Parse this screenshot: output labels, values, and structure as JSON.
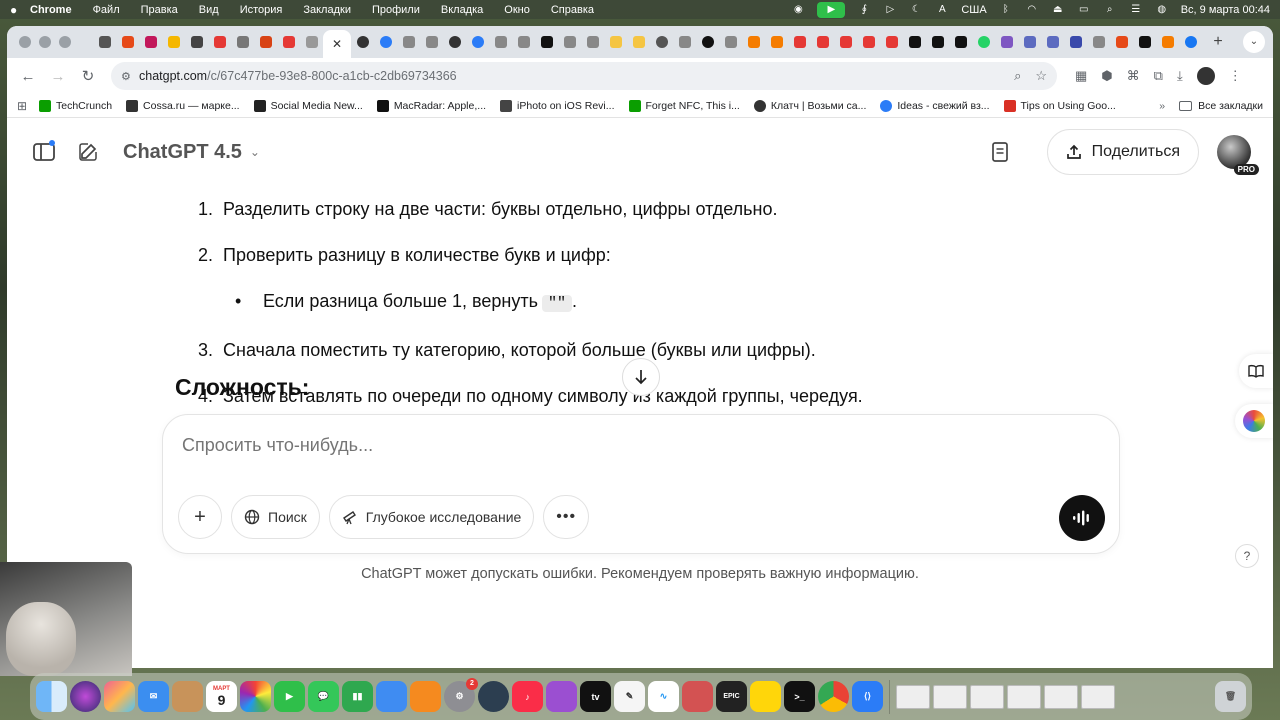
{
  "menubar": {
    "app": "Chrome",
    "items": [
      "Файл",
      "Правка",
      "Вид",
      "История",
      "Закладки",
      "Профили",
      "Вкладка",
      "Окно",
      "Справка"
    ],
    "input_source": "А",
    "region": "США",
    "datetime": "Вс, 9 марта  00:44"
  },
  "browser": {
    "url_host": "chatgpt.com",
    "url_path": "/c/67c477be-93e8-800c-a1cb-c2db69734366",
    "bookmarks": [
      {
        "label": "TechCrunch",
        "color": "#0a9e01"
      },
      {
        "label": "Cossa.ru — марке...",
        "color": "#333333"
      },
      {
        "label": "Social Media New...",
        "color": "#222222"
      },
      {
        "label": "MacRadar: Apple,...",
        "color": "#111111"
      },
      {
        "label": "iPhoto on iOS Revi...",
        "color": "#444444"
      },
      {
        "label": "Forget NFC, This i...",
        "color": "#0a9e01"
      },
      {
        "label": "Клатч | Возьми са...",
        "color": "#333333"
      },
      {
        "label": "Ideas - свежий вз...",
        "color": "#2b7cf7"
      },
      {
        "label": "Tips on Using Goo...",
        "color": "#d93025"
      }
    ],
    "bookmarks_all": "Все закладки"
  },
  "chat": {
    "model": "ChatGPT 4.5",
    "share_label": "Поделиться",
    "pro_badge": "PRO",
    "steps": [
      {
        "num": "1.",
        "text": "Разделить строку на две части: буквы отдельно, цифры отдельно."
      },
      {
        "num": "2.",
        "text": "Проверить разницу в количестве букв и цифр:"
      },
      {
        "num": "3.",
        "text": "Сначала поместить ту категорию, которой больше (буквы или цифры)."
      },
      {
        "num": "4.",
        "text": "Затем вставлять по очереди по одному символу из каждой группы, чередуя."
      }
    ],
    "sub_bullet_text": "Если разница больше 1, вернуть",
    "sub_bullet_code": "\"\"",
    "sub_bullet_end": ".",
    "section_title": "Сложность:",
    "input_placeholder": "Спросить что-нибудь...",
    "search_label": "Поиск",
    "deep_research_label": "Глубокое исследование",
    "disclaimer": "ChatGPT может допускать ошибки. Рекомендуем проверять важную информацию.",
    "help": "?"
  },
  "dock": {
    "calendar_month": "МАРТ",
    "calendar_day": "9",
    "badge_count": "2"
  }
}
